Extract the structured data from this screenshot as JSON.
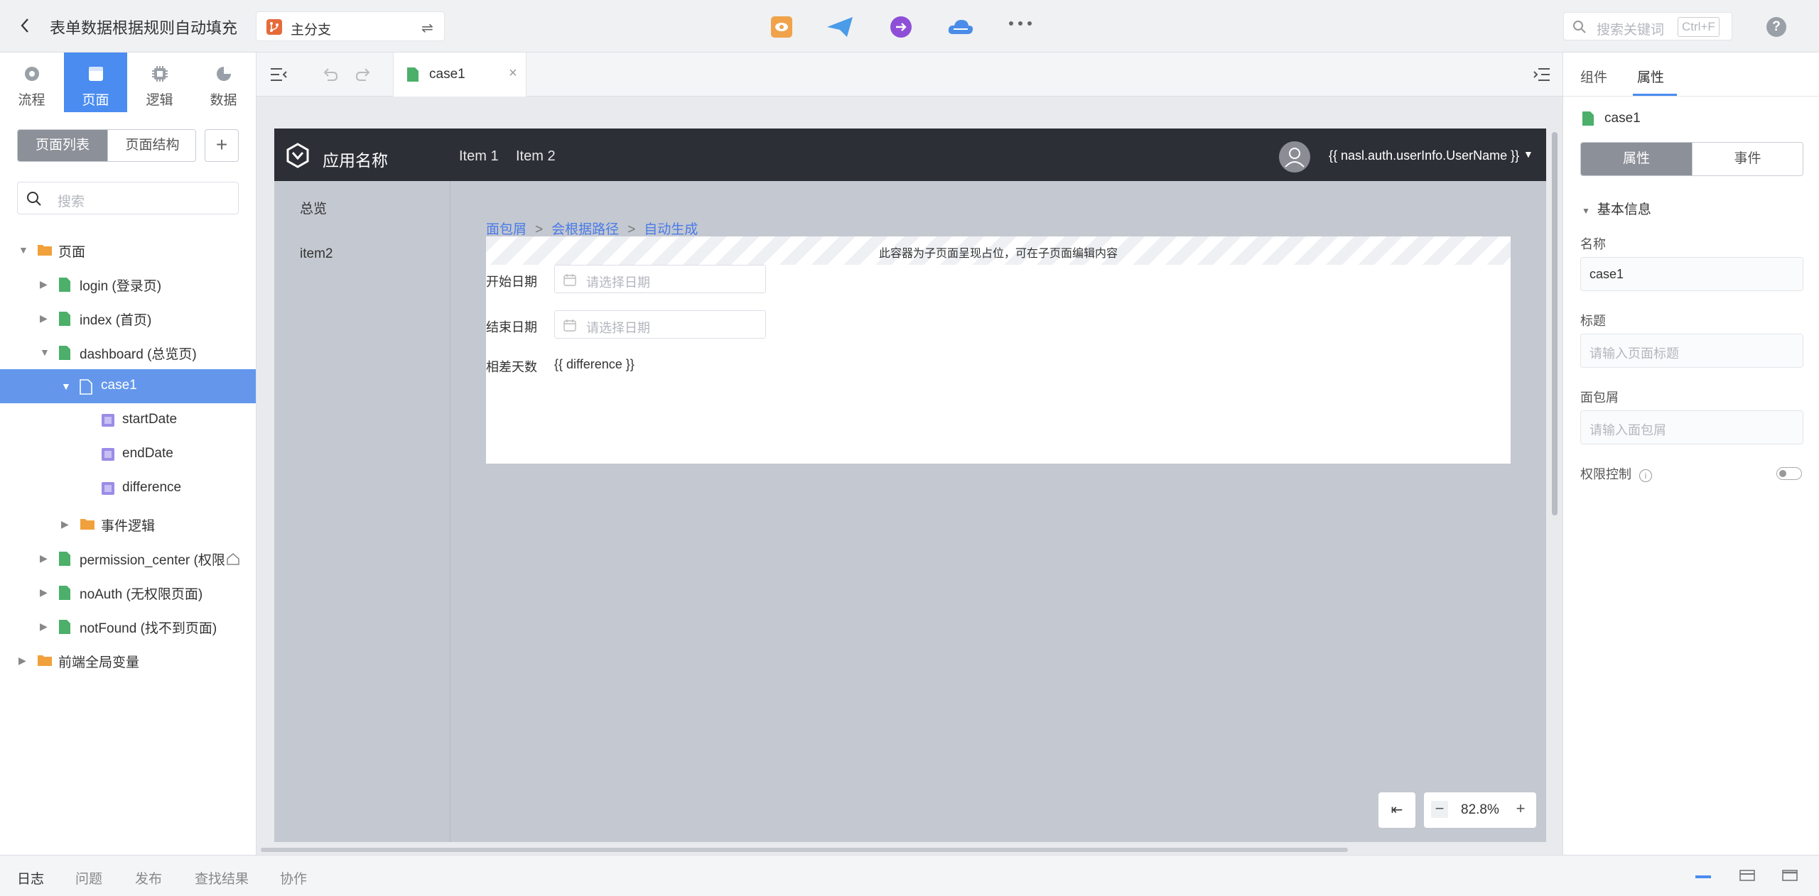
{
  "topbar": {
    "title": "表单数据根据规则自动填充",
    "branch": "主分支",
    "search_placeholder": "搜索关键词",
    "search_shortcut": "Ctrl+F",
    "help": "?"
  },
  "left_nav": [
    {
      "label": "流程",
      "icon": "flow-icon"
    },
    {
      "label": "页面",
      "icon": "page-icon",
      "active": true
    },
    {
      "label": "逻辑",
      "icon": "logic-icon"
    },
    {
      "label": "数据",
      "icon": "data-icon"
    }
  ],
  "page_tabs": {
    "list": "页面列表",
    "structure": "页面结构",
    "add": "+"
  },
  "tree_search_placeholder": "搜索",
  "tree": {
    "root": "页面",
    "login": "login (登录页)",
    "index": "index (首页)",
    "dashboard": "dashboard (总览页)",
    "case1": "case1",
    "startDate": "startDate",
    "endDate": "endDate",
    "difference": "difference",
    "events": "事件逻辑",
    "permission": "permission_center (权限",
    "noAuth": "noAuth (无权限页面)",
    "notFound": "notFound (找不到页面)",
    "globals": "前端全局变量"
  },
  "editor": {
    "tab_label": "case1",
    "tab_close": "×"
  },
  "app": {
    "name": "应用名称",
    "nav": [
      "Item 1",
      "Item 2"
    ],
    "user": "{{ nasl.auth.userInfo.UserName }}",
    "sidebar": [
      "总览",
      "item2"
    ],
    "breadcrumb": [
      "面包屑",
      "会根据路径",
      "自动生成"
    ],
    "placeholder_note": "此容器为子页面呈现占位，可在子页面编辑内容",
    "form": {
      "start_label": "开始日期",
      "start_placeholder": "请选择日期",
      "end_label": "结束日期",
      "end_placeholder": "请选择日期",
      "diff_label": "相差天数",
      "diff_value": "{{ difference }}"
    }
  },
  "zoom": {
    "collapse": "⇤",
    "minus": "−",
    "value": "82.8%",
    "plus": "+"
  },
  "right_panel": {
    "tabs": {
      "components": "组件",
      "properties": "属性"
    },
    "file_name": "case1",
    "seg": {
      "properties": "属性",
      "events": "事件"
    },
    "section": "基本信息",
    "name_label": "名称",
    "name_value": "case1",
    "title_label": "标题",
    "title_placeholder": "请输入页面标题",
    "breadcrumb_label": "面包屑",
    "breadcrumb_placeholder": "请输入面包屑",
    "permission_label": "权限控制",
    "permission_on": false
  },
  "bottom_tabs": [
    "日志",
    "问题",
    "发布",
    "查找结果",
    "协作"
  ],
  "colors": {
    "accent": "#4a8cf0",
    "selected_row": "#6497ec",
    "app_header": "#2c2f36"
  }
}
